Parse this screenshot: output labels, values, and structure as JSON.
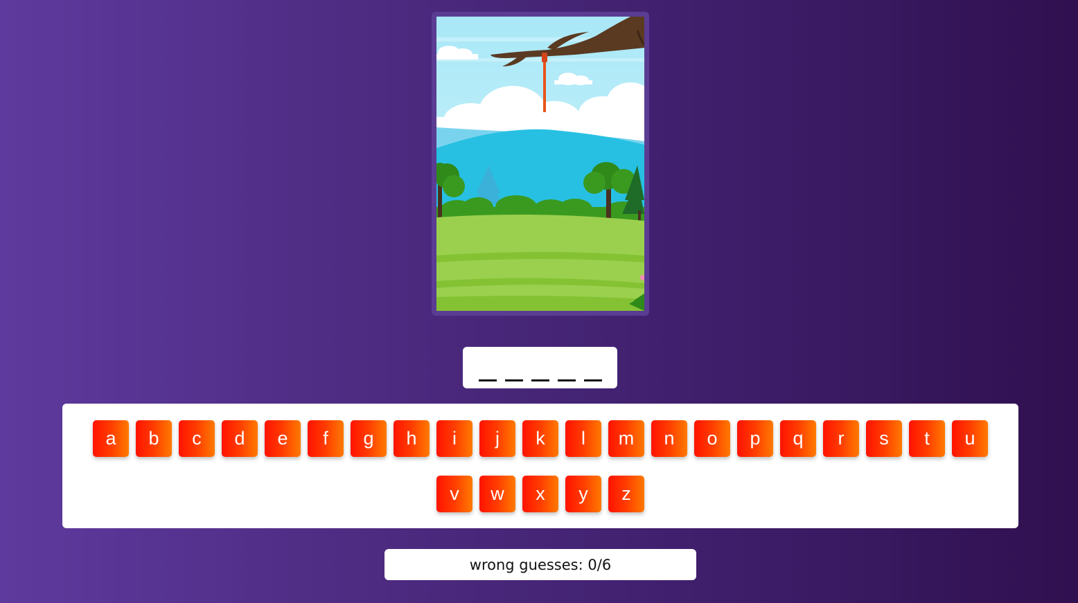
{
  "word": {
    "blanks": [
      "",
      "",
      "",
      "",
      ""
    ]
  },
  "keyboard": {
    "letters": [
      "a",
      "b",
      "c",
      "d",
      "e",
      "f",
      "g",
      "h",
      "i",
      "j",
      "k",
      "l",
      "m",
      "n",
      "o",
      "p",
      "q",
      "r",
      "s",
      "t",
      "u",
      "v",
      "w",
      "x",
      "y",
      "z"
    ]
  },
  "status": {
    "label": "wrong guesses:",
    "wrong": "0",
    "max": "6"
  },
  "colors": {
    "key_gradient_start": "#ff1300",
    "key_gradient_end": "#ff7a00",
    "frame": "#5a3c92"
  }
}
